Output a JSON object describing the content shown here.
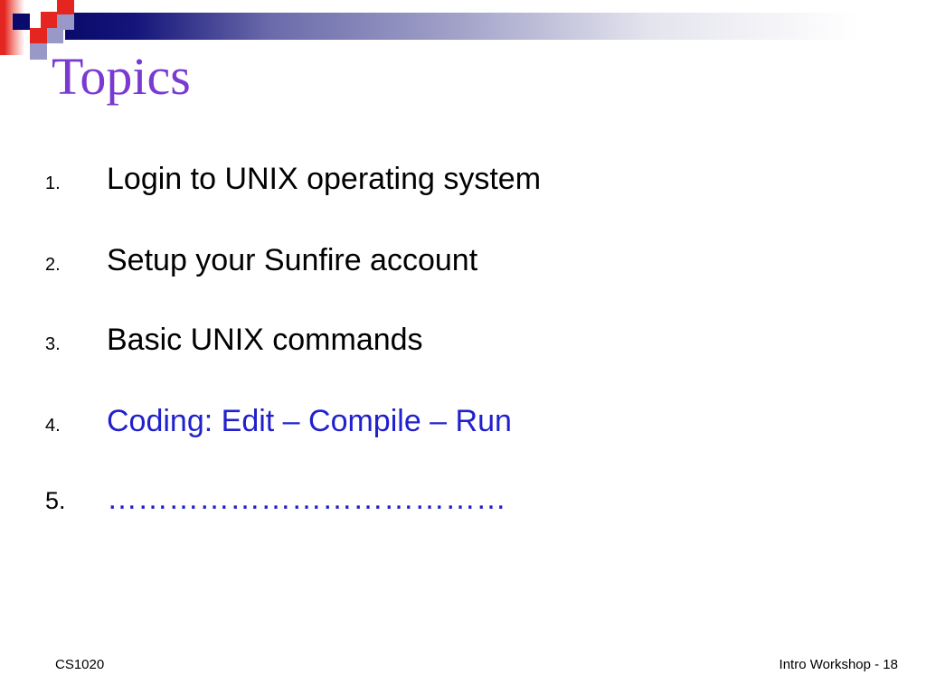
{
  "slide": {
    "title": "Topics",
    "topics": [
      {
        "number": "1.",
        "text": "Login to UNIX operating system",
        "color": "black"
      },
      {
        "number": "2.",
        "text": "Setup your Sunfire account",
        "color": "black"
      },
      {
        "number": "3.",
        "text": "Basic UNIX commands",
        "color": "black"
      },
      {
        "number": "4.",
        "text": "Coding: Edit – Compile – Run",
        "color": "blue"
      },
      {
        "number": "5.",
        "text": "…………………………………",
        "color": "blue"
      }
    ],
    "footer": {
      "left": "CS1020",
      "right": "Intro Workshop - 18"
    }
  },
  "colors": {
    "red": "#e42520",
    "navy": "#0a0a6c",
    "slate": "#9999c8",
    "purple": "#7a3ad2",
    "blue": "#2121cc"
  }
}
